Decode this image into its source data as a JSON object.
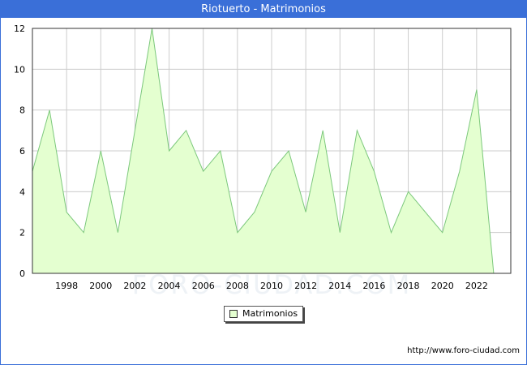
{
  "header": {
    "title": "Riotuerto - Matrimonios"
  },
  "source_url": "http://www.foro-ciudad.com",
  "watermark": "FORO-CIUDAD.COM",
  "colors": {
    "title_bar": "#3a6fd8",
    "fill": "#e4ffd0",
    "line": "#7cc87c",
    "grid": "#cccccc"
  },
  "chart_data": {
    "type": "area",
    "title": "Riotuerto - Matrimonios",
    "xlabel": "",
    "ylabel": "",
    "x": [
      1996,
      1997,
      1998,
      1999,
      2000,
      2001,
      2002,
      2003,
      2004,
      2005,
      2006,
      2007,
      2008,
      2009,
      2010,
      2011,
      2012,
      2013,
      2014,
      2015,
      2016,
      2017,
      2018,
      2019,
      2020,
      2021,
      2022,
      2023
    ],
    "series": [
      {
        "name": "Matrimonios",
        "values": [
          5,
          8,
          3,
          2,
          6,
          2,
          7,
          12,
          6,
          7,
          5,
          6,
          2,
          3,
          5,
          6,
          3,
          7,
          2,
          7,
          5,
          2,
          4,
          3,
          2,
          5,
          9,
          0
        ]
      }
    ],
    "xlim": [
      1996,
      2024
    ],
    "ylim": [
      0,
      12
    ],
    "xticks": [
      1998,
      2000,
      2002,
      2004,
      2006,
      2008,
      2010,
      2012,
      2014,
      2016,
      2018,
      2020,
      2022
    ],
    "yticks": [
      0,
      2,
      4,
      6,
      8,
      10,
      12
    ],
    "grid": true,
    "legend_position": "bottom-center"
  }
}
